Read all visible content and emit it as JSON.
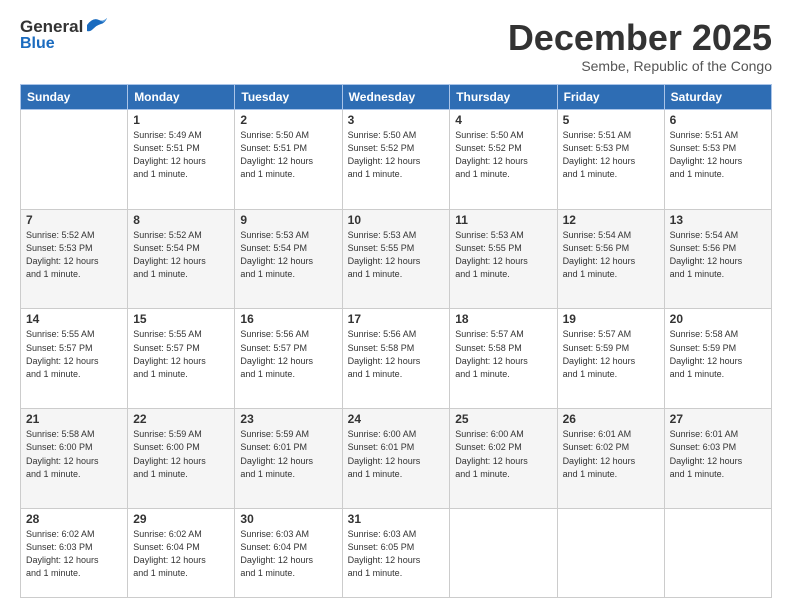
{
  "logo": {
    "line1": "General",
    "line2": "Blue"
  },
  "header": {
    "month": "December 2025",
    "location": "Sembe, Republic of the Congo"
  },
  "days_of_week": [
    "Sunday",
    "Monday",
    "Tuesday",
    "Wednesday",
    "Thursday",
    "Friday",
    "Saturday"
  ],
  "weeks": [
    [
      {
        "day": "",
        "info": ""
      },
      {
        "day": "1",
        "info": "Sunrise: 5:49 AM\nSunset: 5:51 PM\nDaylight: 12 hours\nand 1 minute."
      },
      {
        "day": "2",
        "info": "Sunrise: 5:50 AM\nSunset: 5:51 PM\nDaylight: 12 hours\nand 1 minute."
      },
      {
        "day": "3",
        "info": "Sunrise: 5:50 AM\nSunset: 5:52 PM\nDaylight: 12 hours\nand 1 minute."
      },
      {
        "day": "4",
        "info": "Sunrise: 5:50 AM\nSunset: 5:52 PM\nDaylight: 12 hours\nand 1 minute."
      },
      {
        "day": "5",
        "info": "Sunrise: 5:51 AM\nSunset: 5:53 PM\nDaylight: 12 hours\nand 1 minute."
      },
      {
        "day": "6",
        "info": "Sunrise: 5:51 AM\nSunset: 5:53 PM\nDaylight: 12 hours\nand 1 minute."
      }
    ],
    [
      {
        "day": "7",
        "info": "Sunrise: 5:52 AM\nSunset: 5:53 PM\nDaylight: 12 hours\nand 1 minute."
      },
      {
        "day": "8",
        "info": "Sunrise: 5:52 AM\nSunset: 5:54 PM\nDaylight: 12 hours\nand 1 minute."
      },
      {
        "day": "9",
        "info": "Sunrise: 5:53 AM\nSunset: 5:54 PM\nDaylight: 12 hours\nand 1 minute."
      },
      {
        "day": "10",
        "info": "Sunrise: 5:53 AM\nSunset: 5:55 PM\nDaylight: 12 hours\nand 1 minute."
      },
      {
        "day": "11",
        "info": "Sunrise: 5:53 AM\nSunset: 5:55 PM\nDaylight: 12 hours\nand 1 minute."
      },
      {
        "day": "12",
        "info": "Sunrise: 5:54 AM\nSunset: 5:56 PM\nDaylight: 12 hours\nand 1 minute."
      },
      {
        "day": "13",
        "info": "Sunrise: 5:54 AM\nSunset: 5:56 PM\nDaylight: 12 hours\nand 1 minute."
      }
    ],
    [
      {
        "day": "14",
        "info": "Sunrise: 5:55 AM\nSunset: 5:57 PM\nDaylight: 12 hours\nand 1 minute."
      },
      {
        "day": "15",
        "info": "Sunrise: 5:55 AM\nSunset: 5:57 PM\nDaylight: 12 hours\nand 1 minute."
      },
      {
        "day": "16",
        "info": "Sunrise: 5:56 AM\nSunset: 5:57 PM\nDaylight: 12 hours\nand 1 minute."
      },
      {
        "day": "17",
        "info": "Sunrise: 5:56 AM\nSunset: 5:58 PM\nDaylight: 12 hours\nand 1 minute."
      },
      {
        "day": "18",
        "info": "Sunrise: 5:57 AM\nSunset: 5:58 PM\nDaylight: 12 hours\nand 1 minute."
      },
      {
        "day": "19",
        "info": "Sunrise: 5:57 AM\nSunset: 5:59 PM\nDaylight: 12 hours\nand 1 minute."
      },
      {
        "day": "20",
        "info": "Sunrise: 5:58 AM\nSunset: 5:59 PM\nDaylight: 12 hours\nand 1 minute."
      }
    ],
    [
      {
        "day": "21",
        "info": "Sunrise: 5:58 AM\nSunset: 6:00 PM\nDaylight: 12 hours\nand 1 minute."
      },
      {
        "day": "22",
        "info": "Sunrise: 5:59 AM\nSunset: 6:00 PM\nDaylight: 12 hours\nand 1 minute."
      },
      {
        "day": "23",
        "info": "Sunrise: 5:59 AM\nSunset: 6:01 PM\nDaylight: 12 hours\nand 1 minute."
      },
      {
        "day": "24",
        "info": "Sunrise: 6:00 AM\nSunset: 6:01 PM\nDaylight: 12 hours\nand 1 minute."
      },
      {
        "day": "25",
        "info": "Sunrise: 6:00 AM\nSunset: 6:02 PM\nDaylight: 12 hours\nand 1 minute."
      },
      {
        "day": "26",
        "info": "Sunrise: 6:01 AM\nSunset: 6:02 PM\nDaylight: 12 hours\nand 1 minute."
      },
      {
        "day": "27",
        "info": "Sunrise: 6:01 AM\nSunset: 6:03 PM\nDaylight: 12 hours\nand 1 minute."
      }
    ],
    [
      {
        "day": "28",
        "info": "Sunrise: 6:02 AM\nSunset: 6:03 PM\nDaylight: 12 hours\nand 1 minute."
      },
      {
        "day": "29",
        "info": "Sunrise: 6:02 AM\nSunset: 6:04 PM\nDaylight: 12 hours\nand 1 minute."
      },
      {
        "day": "30",
        "info": "Sunrise: 6:03 AM\nSunset: 6:04 PM\nDaylight: 12 hours\nand 1 minute."
      },
      {
        "day": "31",
        "info": "Sunrise: 6:03 AM\nSunset: 6:05 PM\nDaylight: 12 hours\nand 1 minute."
      },
      {
        "day": "",
        "info": ""
      },
      {
        "day": "",
        "info": ""
      },
      {
        "day": "",
        "info": ""
      }
    ]
  ]
}
